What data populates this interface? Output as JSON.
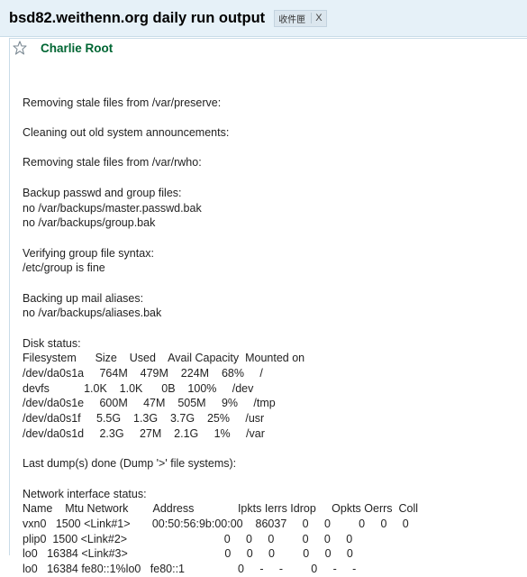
{
  "header": {
    "subject": "bsd82.weithenn.org daily run output",
    "label": "收件匣",
    "label_remove": "X"
  },
  "message": {
    "sender": "Charlie Root",
    "lines": [
      "",
      "Removing stale files from /var/preserve:",
      "",
      "Cleaning out old system announcements:",
      "",
      "Removing stale files from /var/rwho:",
      "",
      "Backup passwd and group files:",
      "no /var/backups/master.passwd.bak",
      "no /var/backups/group.bak",
      "",
      "Verifying group file syntax:",
      "/etc/group is fine",
      "",
      "Backing up mail aliases:",
      "no /var/backups/aliases.bak",
      "",
      "Disk status:",
      "Filesystem      Size    Used    Avail Capacity  Mounted on",
      "/dev/da0s1a     764M    479M    224M    68%     /",
      "devfs           1.0K    1.0K      0B    100%     /dev",
      "/dev/da0s1e     600M     47M    505M     9%     /tmp",
      "/dev/da0s1f     5.5G    1.3G    3.7G    25%     /usr",
      "/dev/da0s1d     2.3G     27M    2.1G     1%     /var",
      "",
      "Last dump(s) done (Dump '>' file systems):",
      "",
      "Network interface status:",
      "Name    Mtu Network        Address              Ipkts Ierrs Idrop     Opkts Oerrs  Coll",
      "vxn0   1500 <Link#1>       00:50:56:9b:00:00    86037     0     0         0     0     0",
      "plip0  1500 <Link#2>                               0     0     0         0     0     0",
      "lo0   16384 <Link#3>                               0     0     0         0     0     0",
      "lo0   16384 fe80::1%lo0   fe80::1                 0     -     -         0     -     -"
    ]
  }
}
